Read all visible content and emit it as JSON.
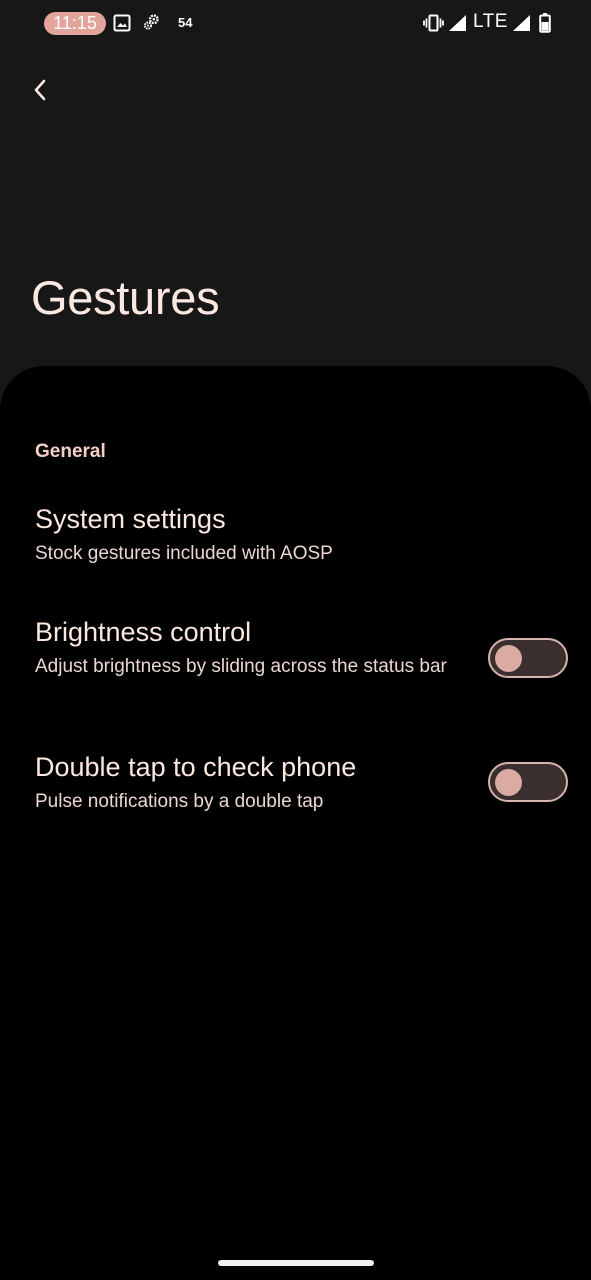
{
  "status_bar": {
    "time": "11:15",
    "notification_count": "54",
    "network": "LTE",
    "icons": [
      "image-icon",
      "settings-gear-icon",
      "vibrate-icon",
      "signal-icon",
      "signal-icon",
      "battery-icon"
    ]
  },
  "nav": {
    "back_icon": "chevron-left-icon"
  },
  "page": {
    "title": "Gestures"
  },
  "section": {
    "header": "General"
  },
  "preferences": [
    {
      "title": "System settings",
      "summary": "Stock gestures included with AOSP"
    },
    {
      "title": "Brightness control",
      "summary": "Adjust brightness by sliding across the status bar",
      "toggle_on": false
    },
    {
      "title": "Double tap to check phone",
      "summary": "Pulse notifications by a double tap",
      "toggle_on": false
    }
  ],
  "colors": {
    "header_bg": "#171717",
    "accent": "#e3a49c",
    "text_primary": "#fbe8e0",
    "toggle_track": "#3a2f2e",
    "toggle_thumb": "#d9aba3"
  }
}
